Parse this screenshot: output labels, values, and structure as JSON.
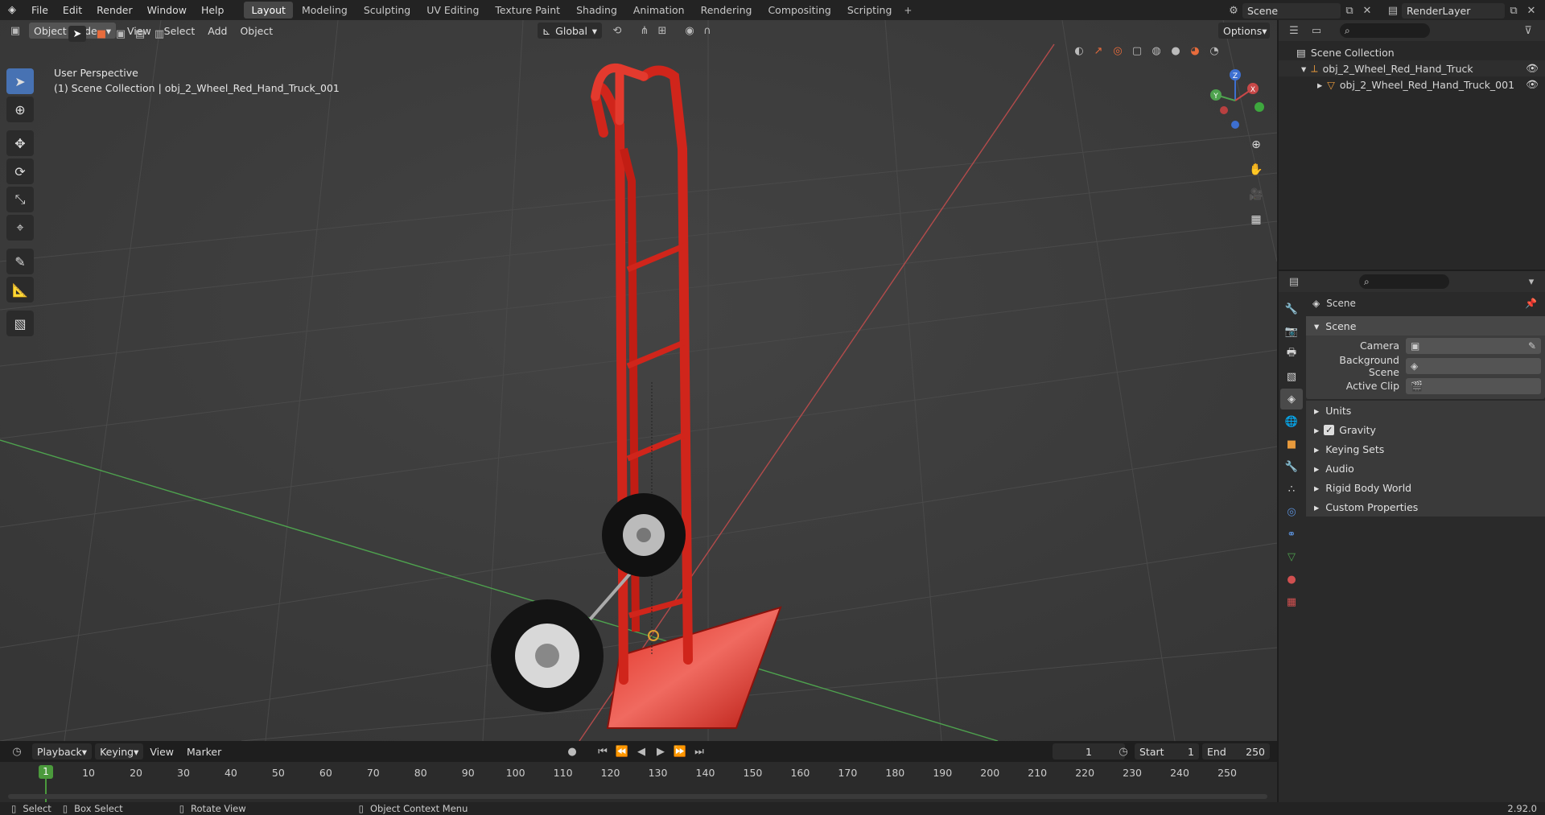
{
  "topbar": {
    "menus": [
      "File",
      "Edit",
      "Render",
      "Window",
      "Help"
    ],
    "workspaces": [
      "Layout",
      "Modeling",
      "Sculpting",
      "UV Editing",
      "Texture Paint",
      "Shading",
      "Animation",
      "Rendering",
      "Compositing",
      "Scripting"
    ],
    "active_workspace": "Layout",
    "scene": "Scene",
    "view_layer": "RenderLayer"
  },
  "viewport_header": {
    "mode": "Object Mode",
    "menus": [
      "View",
      "Select",
      "Add",
      "Object"
    ],
    "orientation": "Global",
    "options": "Options"
  },
  "viewport": {
    "perspective": "User Perspective",
    "collection_info": "(1) Scene Collection | obj_2_Wheel_Red_Hand_Truck_001",
    "gizmo": {
      "x": "X",
      "y": "Y",
      "z": "Z"
    },
    "colors": {
      "x_axis": "#b34b4b",
      "y_axis": "#4ea24e",
      "object": "#d0251b"
    }
  },
  "outliner": {
    "root": "Scene Collection",
    "items": [
      {
        "label": "obj_2_Wheel_Red_Hand_Truck",
        "icon": "empty-axes-icon"
      },
      {
        "label": "obj_2_Wheel_Red_Hand_Truck_001",
        "icon": "mesh-icon"
      }
    ]
  },
  "properties": {
    "context": "Scene",
    "panel_title": "Scene",
    "fields": [
      {
        "label": "Camera"
      },
      {
        "label": "Background Scene"
      },
      {
        "label": "Active Clip"
      }
    ],
    "subpanels": [
      "Units",
      "Gravity",
      "Keying Sets",
      "Audio",
      "Rigid Body World",
      "Custom Properties"
    ]
  },
  "timeline": {
    "menus": [
      "Playback",
      "Keying",
      "View",
      "Marker"
    ],
    "current_frame": "1",
    "start_label": "Start",
    "start": "1",
    "end_label": "End",
    "end": "250",
    "ticks": [
      "1",
      "10",
      "20",
      "30",
      "40",
      "50",
      "60",
      "70",
      "80",
      "90",
      "100",
      "110",
      "120",
      "130",
      "140",
      "150",
      "160",
      "170",
      "180",
      "190",
      "200",
      "210",
      "220",
      "230",
      "240",
      "250"
    ],
    "playhead_frame": "1"
  },
  "statusbar": {
    "select": "Select",
    "box_select": "Box Select",
    "rotate_view": "Rotate View",
    "context_menu": "Object Context Menu",
    "version": "2.92.0"
  }
}
